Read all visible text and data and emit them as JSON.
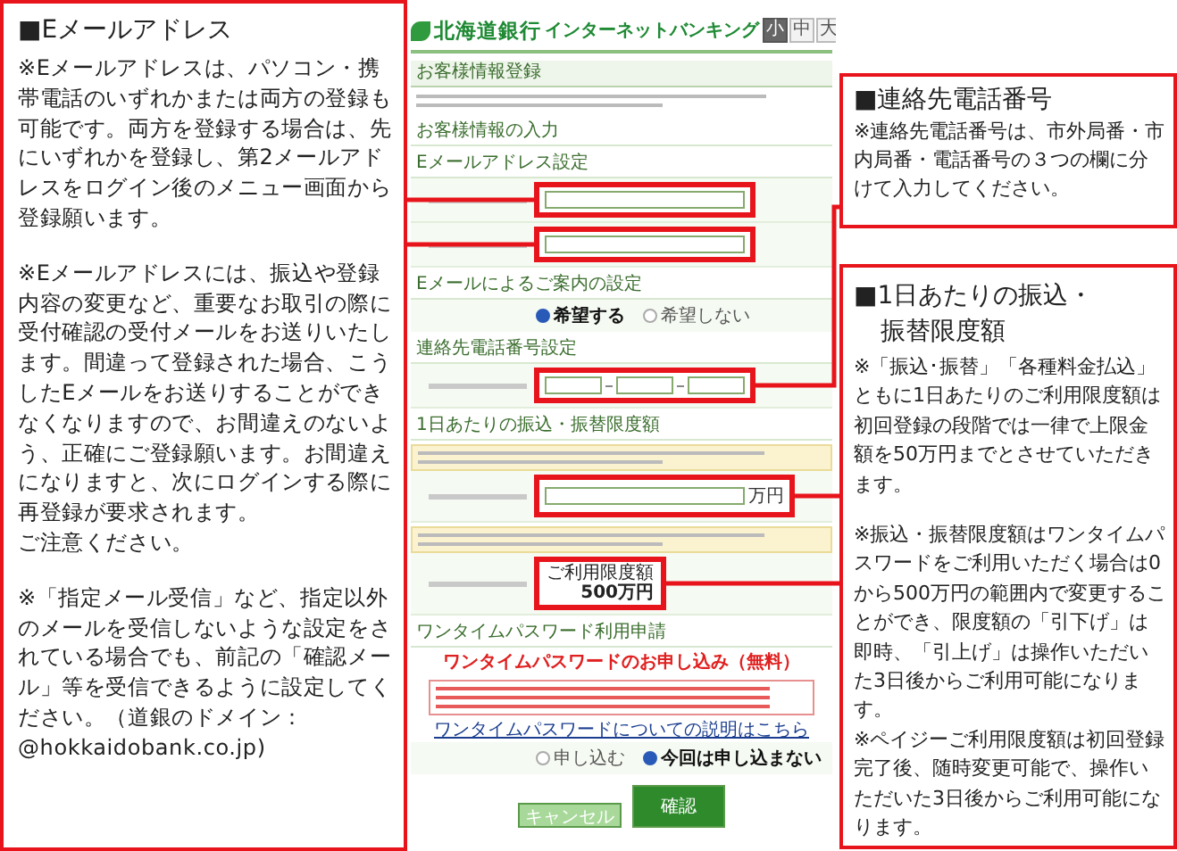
{
  "left_note": {
    "heading": "■Eメールアドレス",
    "paragraphs": [
      [
        "※Eメールアドレスは、パソコン・携帯電話のいずれかまたは両方の登録も可能です。両方を登録する場合は、先にいずれかを登録し、第2メールアドレスをログイン後のメニュー画面から登録願います。"
      ],
      [
        "※Eメールアドレスには、振込や登録内容の変更など、重要なお取引の際に受付確認の受付メールをお送りいたします。間違って登録された場合、こうしたEメールをお送りすることができなくなりますので、お間違えのないよう、正確にご登録願います。お間違えになりますと、次にログインする際に再登録が要求されます。",
        "ご注意ください。"
      ],
      [
        "※「指定メール受信」など、指定以外のメールを受信しないような設定をされている場合でも、前記の「確認メール」等を受信できるように設定してください。（道銀のドメイン：@hokkaidobank.co.jp)"
      ]
    ]
  },
  "screenshot": {
    "logo": "北海道銀行",
    "service": "インターネットバンキング",
    "font_sizes": [
      {
        "label": "小",
        "selected": true
      },
      {
        "label": "中",
        "selected": false
      },
      {
        "label": "大",
        "selected": false
      }
    ],
    "blocks": [
      {
        "kind": "title",
        "text": "お客様情報登録"
      },
      {
        "kind": "fine_print"
      },
      {
        "kind": "heading",
        "text": "お客様情報の入力"
      },
      {
        "kind": "subheading",
        "text": "Eメールアドレス設定"
      },
      {
        "kind": "email_row",
        "highlighted": true
      },
      {
        "kind": "email_row",
        "highlighted": true
      },
      {
        "kind": "subheading",
        "text": "Eメールによるご案内の設定"
      },
      {
        "kind": "radio_row",
        "options": [
          {
            "label": "希望する",
            "selected": true
          },
          {
            "label": "希望しない",
            "selected": false
          }
        ]
      },
      {
        "kind": "subheading",
        "text": "連絡先電話番号設定"
      },
      {
        "kind": "phone_row",
        "highlighted": true
      },
      {
        "kind": "subheading",
        "text": "1日あたりの振込・振替限度額"
      },
      {
        "kind": "note"
      },
      {
        "kind": "limit_row",
        "unit": "万円",
        "highlighted": true
      },
      {
        "kind": "note"
      },
      {
        "kind": "value_row",
        "label": "ご利用限度額",
        "value": "500万円",
        "highlighted": true
      },
      {
        "kind": "subheading",
        "text": "ワンタイムパスワード利用申請"
      },
      {
        "kind": "red_title",
        "text": "ワンタイムパスワードのお申し込み（無料）"
      },
      {
        "kind": "notice"
      },
      {
        "kind": "link",
        "text": "ワンタイムパスワードについての説明はこちら"
      },
      {
        "kind": "radio_row",
        "options": [
          {
            "label": "申し込む",
            "selected": false
          },
          {
            "label": "今回は申し込まない",
            "selected": true
          }
        ]
      },
      {
        "kind": "buttons",
        "buttons": [
          {
            "label": "キャンセル",
            "kind": "secondary"
          },
          {
            "label": "確認",
            "kind": "primary"
          }
        ]
      }
    ]
  },
  "right_notes": [
    {
      "heading_lines": [
        "■連絡先電話番号"
      ],
      "paragraphs": [
        [
          "※連絡先電話番号は、市外局番・市内局番・電話番号の３つの欄に分けて入力してください。"
        ]
      ]
    },
    {
      "heading_lines": [
        "■1日あたりの振込・",
        "振替限度額"
      ],
      "paragraphs": [
        [
          "※「振込･振替」「各種料金払込」ともに1日あたりのご利用限度額は初回登録の段階では一律で上限金額を50万円までとさせていただきます。"
        ],
        [
          "※振込・振替限度額はワンタイムパスワードをご利用いただく場合は0から500万円の範囲内で変更することができ、限度額の「引下げ」は即時、「引上げ」は操作いただいた3日後からご利用可能になります。",
          "※ペイジーご利用限度額は初回登録完了後、随時変更可能で、操作いただいた3日後からご利用可能になります。"
        ]
      ]
    }
  ]
}
